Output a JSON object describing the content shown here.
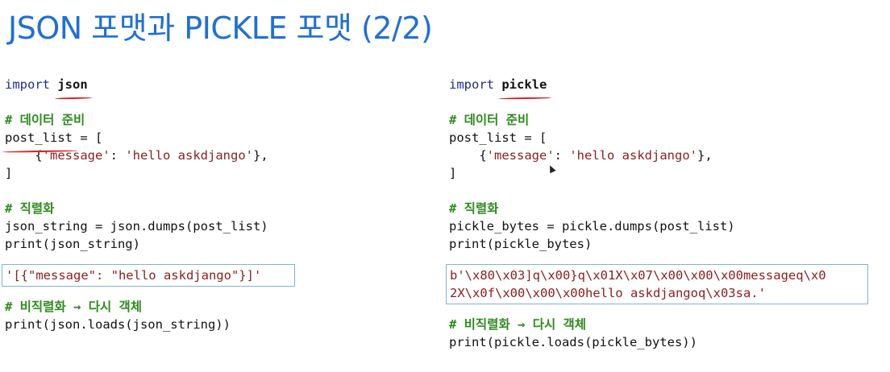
{
  "slide": {
    "title": "JSON 포맷과 PICKLE 포맷 (2/2)"
  },
  "left": {
    "import_kw": "import",
    "import_mod": "json",
    "comment_prep": "# 데이터 준비",
    "post_list_name": "post_list",
    "post_list_open": " = [",
    "dict_open": "    {",
    "dict_key": "'message'",
    "dict_colon": ": ",
    "dict_val": "'hello askdjango'",
    "dict_close": "},",
    "list_close": "]",
    "comment_serialize": "# 직렬화",
    "serialize_line": "json_string = json.dumps(post_list)",
    "print_line": "print(json_string)",
    "output": "'[{\"message\": \"hello askdjango\"}]'",
    "comment_deserialize": "# 비직렬화 → 다시 객체",
    "loads_line": "print(json.loads(json_string))"
  },
  "right": {
    "import_kw": "import",
    "import_mod": "pickle",
    "comment_prep": "# 데이터 준비",
    "post_list_name": "post_list",
    "post_list_open": " = [",
    "dict_open": "    {",
    "dict_key": "'message'",
    "dict_colon": ": ",
    "dict_val": "'hello askdjango'",
    "dict_close": "},",
    "list_close": "]",
    "comment_serialize": "# 직렬화",
    "serialize_line": "pickle_bytes = pickle.dumps(post_list)",
    "print_line": "print(pickle_bytes)",
    "output_line1": "b'\\x80\\x03]q\\x00}q\\x01X\\x07\\x00\\x00\\x00messageq\\x0",
    "output_line2": "2X\\x0f\\x00\\x00\\x00hello askdjangoq\\x03sa.'",
    "comment_deserialize": "# 비직렬화 → 다시 객체",
    "loads_line": "print(pickle.loads(pickle_bytes))"
  },
  "colors": {
    "title": "#1f6fd6",
    "keyword": "#1d2b8f",
    "comment": "#2e8b1e",
    "string": "#8b2020",
    "underline": "#d42323",
    "box_border": "#7fb2dc"
  },
  "icons": {
    "cursor": "mouse-cursor-icon"
  }
}
